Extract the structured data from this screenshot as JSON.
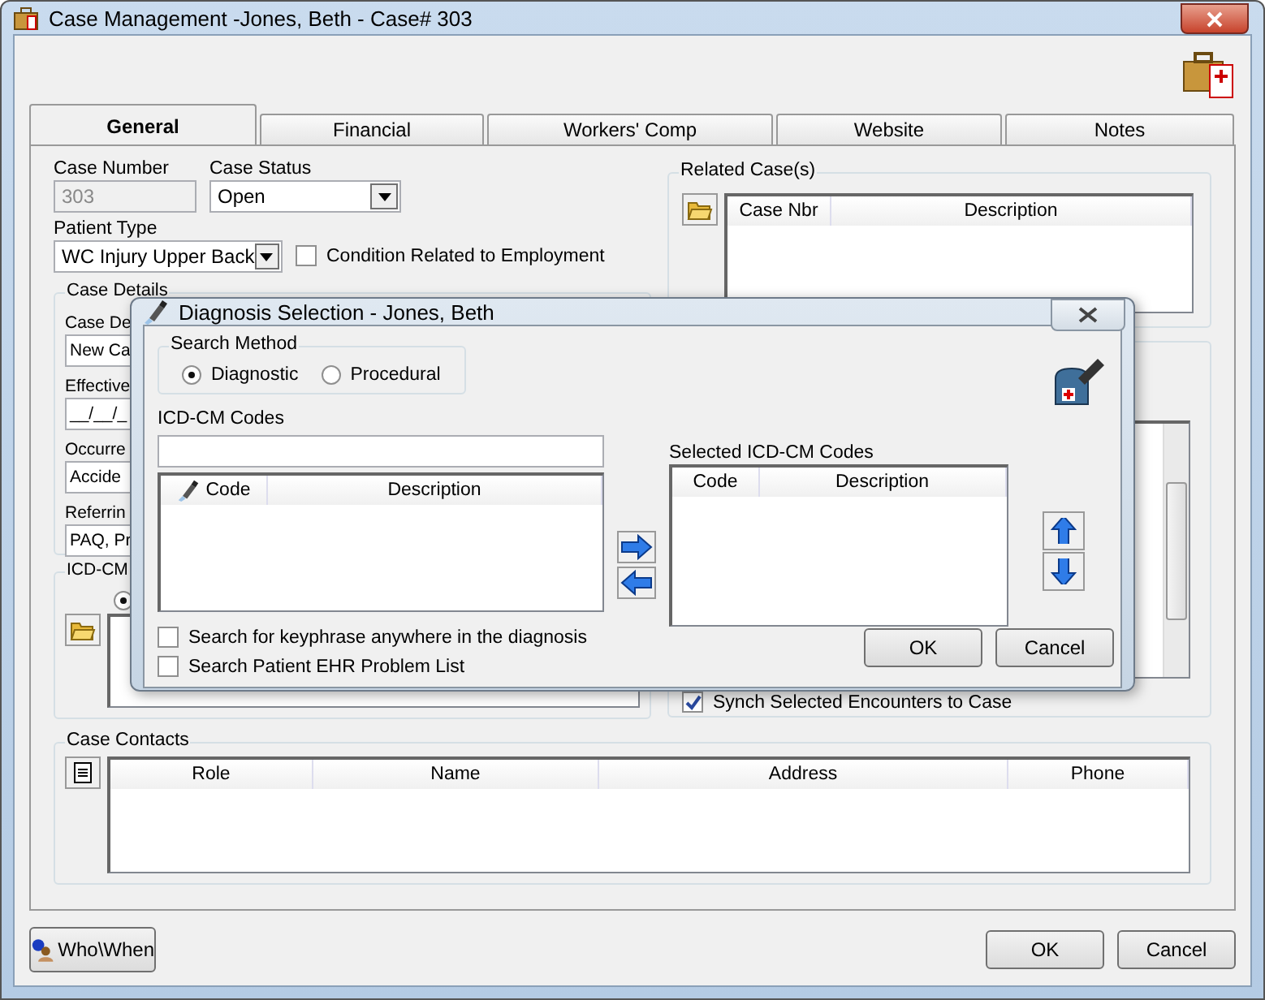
{
  "window": {
    "title": "Case Management -Jones, Beth  - Case#  303"
  },
  "tabs": [
    {
      "label": "General",
      "selected": true
    },
    {
      "label": "Financial",
      "selected": false
    },
    {
      "label": "Workers' Comp",
      "selected": false
    },
    {
      "label": "Website",
      "selected": false
    },
    {
      "label": "Notes",
      "selected": false
    }
  ],
  "case_number": {
    "label": "Case Number",
    "value": "303",
    "disabled": true
  },
  "case_status": {
    "label": "Case Status",
    "value": "Open"
  },
  "patient_type": {
    "label": "Patient Type",
    "value": "WC Injury Upper Back"
  },
  "condition_checkbox": {
    "label": "Condition Related to Employment",
    "checked": false
  },
  "case_details": {
    "title": "Case Details",
    "fields": [
      {
        "label": "Case De",
        "value": "New Ca"
      },
      {
        "label": "Effective",
        "value": "__/__/_"
      },
      {
        "label": "Occurre",
        "value": "Accide"
      },
      {
        "label": "Referrin",
        "value": "PAQ, Pr"
      }
    ]
  },
  "icd_group": {
    "title": "ICD-CM",
    "radio": {
      "selected": true
    }
  },
  "related_cases": {
    "title": "Related Case(s)",
    "columns": [
      "Case Nbr",
      "Description"
    ]
  },
  "encounters": {
    "synch_checkbox": {
      "label": "Synch Selected Encounters to Case",
      "checked": true
    }
  },
  "case_contacts": {
    "title": "Case Contacts",
    "columns": [
      "Role",
      "Name",
      "Address",
      "Phone"
    ]
  },
  "footer": {
    "who_when": "Who\\When",
    "buttons": [
      "OK",
      "Cancel"
    ]
  },
  "dialog": {
    "title": "Diagnosis Selection - Jones, Beth",
    "search_method": {
      "title": "Search Method",
      "options": [
        {
          "label": "Diagnostic",
          "selected": true
        },
        {
          "label": "Procedural",
          "selected": false
        }
      ]
    },
    "codes": {
      "label": "ICD-CM Codes",
      "columns": [
        "Code",
        "Description"
      ]
    },
    "selected_codes": {
      "label": "Selected ICD-CM Codes",
      "columns": [
        "Code",
        "Description"
      ]
    },
    "options": [
      {
        "label": "Search for keyphrase anywhere in the diagnosis",
        "checked": false
      },
      {
        "label": "Search Patient EHR Problem List",
        "checked": false
      }
    ],
    "buttons": [
      "OK",
      "Cancel"
    ]
  }
}
